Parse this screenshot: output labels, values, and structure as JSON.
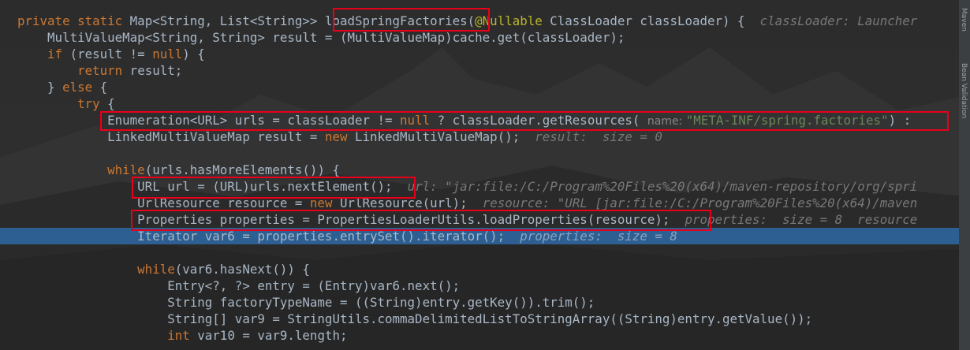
{
  "editor": {
    "lines": [
      {
        "segs": [
          [
            "kw",
            "private static "
          ],
          [
            "c",
            "Map<String, List<String>> loadSpringFactories("
          ],
          [
            "anno",
            "@Nullable"
          ],
          [
            "c",
            " ClassLoader classLoader) {  "
          ],
          [
            "hint",
            "classLoader: Launcher"
          ]
        ]
      },
      {
        "segs": [
          [
            "c",
            "    MultiValueMap<String, String> result = (MultiValueMap)cache.get(classLoader);"
          ]
        ]
      },
      {
        "segs": [
          [
            "c",
            "    "
          ],
          [
            "kw",
            "if"
          ],
          [
            "c",
            " (result != "
          ],
          [
            "kw",
            "null"
          ],
          [
            "c",
            ") {"
          ]
        ]
      },
      {
        "segs": [
          [
            "c",
            "        "
          ],
          [
            "kw",
            "return"
          ],
          [
            "c",
            " result;"
          ]
        ]
      },
      {
        "segs": [
          [
            "c",
            "    } "
          ],
          [
            "kw",
            "else"
          ],
          [
            "c",
            " {"
          ]
        ]
      },
      {
        "segs": [
          [
            "c",
            "        "
          ],
          [
            "kw",
            "try"
          ],
          [
            "c",
            " {"
          ]
        ]
      },
      {
        "segs": [
          [
            "c",
            "            Enumeration<URL> urls = classLoader != "
          ],
          [
            "kw",
            "null"
          ],
          [
            "c",
            " ? classLoader.getResources( "
          ],
          [
            "ph",
            "name: "
          ],
          [
            "str",
            "\"META-INF/spring.factories\""
          ],
          [
            "c",
            ") :"
          ]
        ]
      },
      {
        "segs": [
          [
            "c",
            "            LinkedMultiValueMap result = "
          ],
          [
            "kw",
            "new"
          ],
          [
            "c",
            " LinkedMultiValueMap();  "
          ],
          [
            "hint",
            "result:  size = 0"
          ]
        ]
      },
      {
        "segs": [
          [
            "c",
            ""
          ]
        ]
      },
      {
        "segs": [
          [
            "c",
            "            "
          ],
          [
            "kw",
            "while"
          ],
          [
            "c",
            "(urls.hasMoreElements()) {"
          ]
        ]
      },
      {
        "segs": [
          [
            "c",
            "                URL url = (URL)urls.nextElement();  "
          ],
          [
            "hint",
            "url: \"jar:file:/C:/Program%20Files%20(x64)/maven-repository/org/spri"
          ]
        ]
      },
      {
        "segs": [
          [
            "c",
            "                UrlResource resource = "
          ],
          [
            "kw",
            "new"
          ],
          [
            "c",
            " UrlResource(url);  "
          ],
          [
            "hint",
            "resource: \"URL [jar:file:/C:/Program%20Files%20(x64)/maven"
          ]
        ]
      },
      {
        "segs": [
          [
            "c",
            "                Properties properties = PropertiesLoaderUtils.loadProperties(resource);  "
          ],
          [
            "hint",
            "properties:  size = 8  resource"
          ]
        ]
      },
      {
        "segs": [
          [
            "c",
            "                Iterator var6 = properties.entrySet().iterator();  "
          ],
          [
            "hint",
            "properties:  size = 8"
          ]
        ]
      },
      {
        "segs": [
          [
            "c",
            ""
          ]
        ]
      },
      {
        "segs": [
          [
            "c",
            "                "
          ],
          [
            "kw",
            "while"
          ],
          [
            "c",
            "(var6.hasNext()) {"
          ]
        ]
      },
      {
        "segs": [
          [
            "c",
            "                    Entry<?, ?> entry = (Entry)var6.next();"
          ]
        ]
      },
      {
        "segs": [
          [
            "c",
            "                    String factoryTypeName = ((String)entry.getKey()).trim();"
          ]
        ]
      },
      {
        "segs": [
          [
            "c",
            "                    String[] var9 = StringUtils.commaDelimitedListToStringArray((String)entry.getValue());"
          ]
        ]
      },
      {
        "segs": [
          [
            "c",
            "                    "
          ],
          [
            "kw",
            "int"
          ],
          [
            "c",
            " var10 = var9.length;"
          ]
        ]
      }
    ],
    "current_line": 13
  },
  "side_panel": {
    "labels": [
      "Maven",
      "Bean Validation"
    ]
  }
}
